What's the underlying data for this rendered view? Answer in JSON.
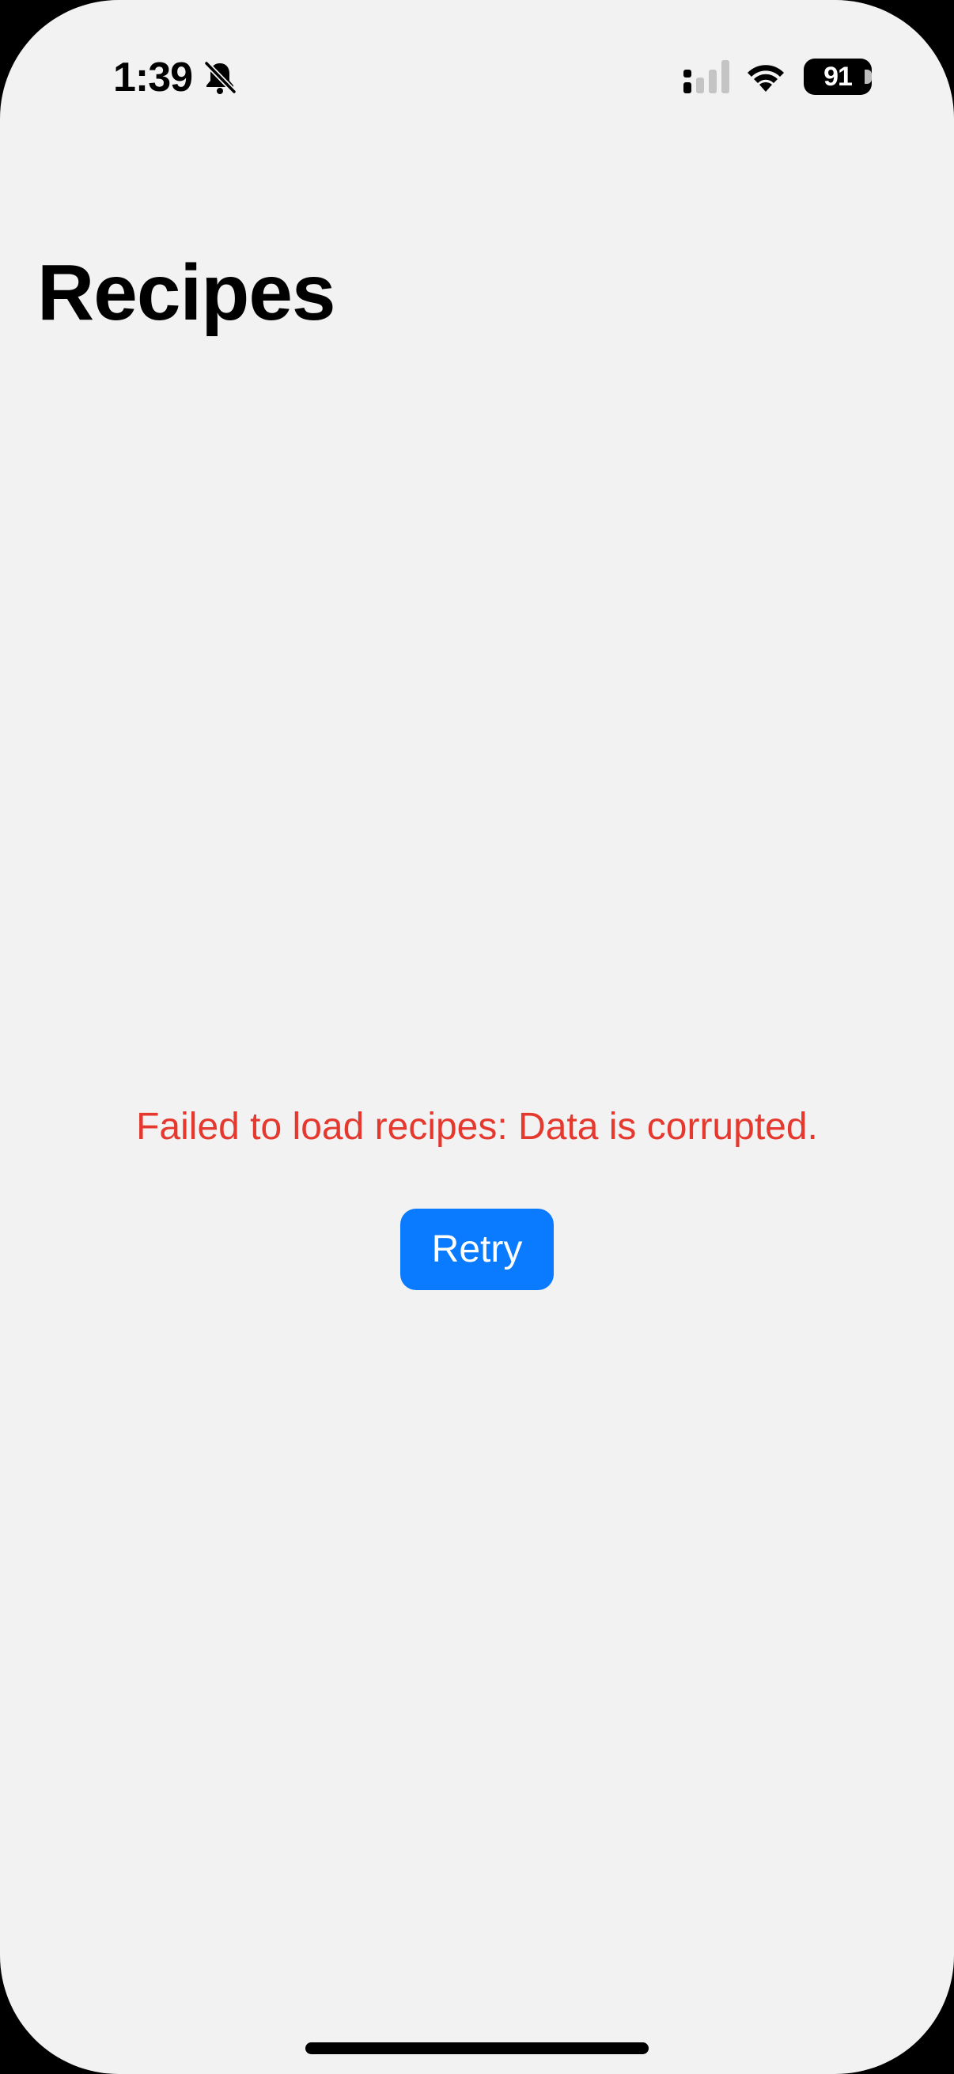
{
  "status_bar": {
    "time": "1:39",
    "battery_level": "91",
    "icons": [
      "bell-slash-icon",
      "cellular-signal-icon",
      "wifi-icon",
      "battery-icon"
    ]
  },
  "header": {
    "title": "Recipes"
  },
  "error": {
    "message": "Failed to load recipes: Data is corrupted.",
    "retry_label": "Retry"
  },
  "colors": {
    "background": "#F2F2F2",
    "error_text": "#E5392F",
    "accent": "#0A7AFF"
  }
}
